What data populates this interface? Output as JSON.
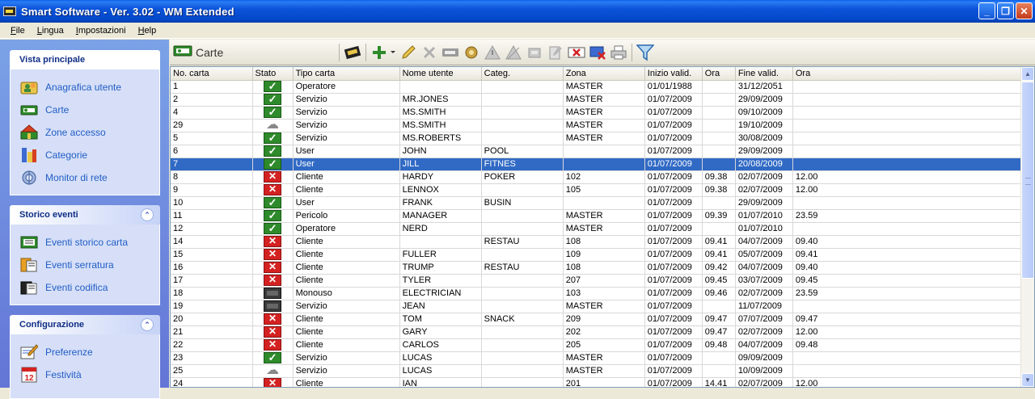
{
  "window": {
    "title": "Smart Software - Ver. 3.02 - WM Extended",
    "minimize": "_",
    "maximize": "❐",
    "close": "✕"
  },
  "menu": [
    {
      "label": "File",
      "accel": "F",
      "rest": "ile"
    },
    {
      "label": "Lingua",
      "accel": "L",
      "rest": "ingua"
    },
    {
      "label": "Impostazioni",
      "accel": "I",
      "rest": "mpostazioni"
    },
    {
      "label": "Help",
      "accel": "H",
      "rest": "elp"
    }
  ],
  "sidebar": {
    "groups": [
      {
        "title": "Vista principale",
        "items": [
          {
            "label": "Anagrafica utente",
            "icon": "users-icon"
          },
          {
            "label": "Carte",
            "icon": "card-icon"
          },
          {
            "label": "Zone accesso",
            "icon": "house-icon"
          },
          {
            "label": "Categorie",
            "icon": "categories-icon"
          },
          {
            "label": "Monitor di rete",
            "icon": "network-monitor-icon"
          }
        ]
      },
      {
        "title": "Storico eventi",
        "items": [
          {
            "label": "Eventi storico carta",
            "icon": "card-history-icon"
          },
          {
            "label": "Eventi serratura",
            "icon": "lock-events-icon"
          },
          {
            "label": "Eventi codifica",
            "icon": "encoding-events-icon"
          }
        ]
      },
      {
        "title": "Configurazione",
        "items": [
          {
            "label": "Preferenze",
            "icon": "preferences-icon"
          },
          {
            "label": "Festività",
            "icon": "calendar-icon"
          }
        ]
      }
    ]
  },
  "toolbar": {
    "title": "Carte"
  },
  "grid": {
    "columns": [
      "No. carta",
      "Stato",
      "Tipo carta",
      "Nome utente",
      "Categ.",
      "Zona",
      "Inizio valid.",
      "Ora",
      "Fine valid.",
      "Ora"
    ],
    "rows": [
      {
        "n": "1",
        "s": "ok",
        "t": "Operatore",
        "u": "",
        "c": "",
        "z": "MASTER",
        "iv": "01/01/1988",
        "io": "",
        "fv": "31/12/2051",
        "fo": ""
      },
      {
        "n": "2",
        "s": "ok",
        "t": "Servizio",
        "u": "MR.JONES",
        "c": "",
        "z": "MASTER",
        "iv": "01/07/2009",
        "io": "",
        "fv": "29/09/2009",
        "fo": ""
      },
      {
        "n": "4",
        "s": "ok",
        "t": "Servizio",
        "u": "MS.SMITH",
        "c": "",
        "z": "MASTER",
        "iv": "01/07/2009",
        "io": "",
        "fv": "09/10/2009",
        "fo": ""
      },
      {
        "n": "29",
        "s": "cloud",
        "t": "Servizio",
        "u": "MS.SMITH",
        "c": "",
        "z": "MASTER",
        "iv": "01/07/2009",
        "io": "",
        "fv": "19/10/2009",
        "fo": ""
      },
      {
        "n": "5",
        "s": "ok",
        "t": "Servizio",
        "u": "MS.ROBERTS",
        "c": "",
        "z": "MASTER",
        "iv": "01/07/2009",
        "io": "",
        "fv": "30/08/2009",
        "fo": ""
      },
      {
        "n": "6",
        "s": "ok",
        "t": "User",
        "u": "JOHN",
        "c": "POOL",
        "z": "",
        "iv": "01/07/2009",
        "io": "",
        "fv": "29/09/2009",
        "fo": ""
      },
      {
        "n": "7",
        "s": "ok",
        "t": "User",
        "u": "JILL",
        "c": "FITNES",
        "z": "",
        "iv": "01/07/2009",
        "io": "",
        "fv": "20/08/2009",
        "fo": "",
        "selected": true
      },
      {
        "n": "8",
        "s": "no",
        "t": "Cliente",
        "u": "HARDY",
        "c": "POKER",
        "z": "102",
        "iv": "01/07/2009",
        "io": "09.38",
        "fv": "02/07/2009",
        "fo": "12.00"
      },
      {
        "n": "9",
        "s": "no",
        "t": "Cliente",
        "u": "LENNOX",
        "c": "",
        "z": "105",
        "iv": "01/07/2009",
        "io": "09.38",
        "fv": "02/07/2009",
        "fo": "12.00"
      },
      {
        "n": "10",
        "s": "ok",
        "t": "User",
        "u": "FRANK",
        "c": "BUSIN",
        "z": "",
        "iv": "01/07/2009",
        "io": "",
        "fv": "29/09/2009",
        "fo": ""
      },
      {
        "n": "11",
        "s": "ok",
        "t": "Pericolo",
        "u": "MANAGER",
        "c": "",
        "z": "MASTER",
        "iv": "01/07/2009",
        "io": "09.39",
        "fv": "01/07/2010",
        "fo": "23.59"
      },
      {
        "n": "12",
        "s": "ok",
        "t": "Operatore",
        "u": "NERD",
        "c": "",
        "z": "MASTER",
        "iv": "01/07/2009",
        "io": "",
        "fv": "01/07/2010",
        "fo": ""
      },
      {
        "n": "14",
        "s": "no",
        "t": "Cliente",
        "u": "",
        "c": "RESTAU",
        "z": "108",
        "iv": "01/07/2009",
        "io": "09.41",
        "fv": "04/07/2009",
        "fo": "09.40"
      },
      {
        "n": "15",
        "s": "no",
        "t": "Cliente",
        "u": "FULLER",
        "c": "",
        "z": "109",
        "iv": "01/07/2009",
        "io": "09.41",
        "fv": "05/07/2009",
        "fo": "09.41"
      },
      {
        "n": "16",
        "s": "no",
        "t": "Cliente",
        "u": "TRUMP",
        "c": "RESTAU",
        "z": "108",
        "iv": "01/07/2009",
        "io": "09.42",
        "fv": "04/07/2009",
        "fo": "09.40"
      },
      {
        "n": "17",
        "s": "no",
        "t": "Cliente",
        "u": "TYLER",
        "c": "",
        "z": "207",
        "iv": "01/07/2009",
        "io": "09.45",
        "fv": "03/07/2009",
        "fo": "09.45"
      },
      {
        "n": "18",
        "s": "off",
        "t": "Monouso",
        "u": "ELECTRICIAN",
        "c": "",
        "z": "103",
        "iv": "01/07/2009",
        "io": "09.46",
        "fv": "02/07/2009",
        "fo": "23.59"
      },
      {
        "n": "19",
        "s": "off",
        "t": "Servizio",
        "u": "JEAN",
        "c": "",
        "z": "MASTER",
        "iv": "01/07/2009",
        "io": "",
        "fv": "11/07/2009",
        "fo": ""
      },
      {
        "n": "20",
        "s": "no",
        "t": "Cliente",
        "u": "TOM",
        "c": "SNACK",
        "z": "209",
        "iv": "01/07/2009",
        "io": "09.47",
        "fv": "07/07/2009",
        "fo": "09.47"
      },
      {
        "n": "21",
        "s": "no",
        "t": "Cliente",
        "u": "GARY",
        "c": "",
        "z": "202",
        "iv": "01/07/2009",
        "io": "09.47",
        "fv": "02/07/2009",
        "fo": "12.00"
      },
      {
        "n": "22",
        "s": "no",
        "t": "Cliente",
        "u": "CARLOS",
        "c": "",
        "z": "205",
        "iv": "01/07/2009",
        "io": "09.48",
        "fv": "04/07/2009",
        "fo": "09.48"
      },
      {
        "n": "23",
        "s": "ok",
        "t": "Servizio",
        "u": "LUCAS",
        "c": "",
        "z": "MASTER",
        "iv": "01/07/2009",
        "io": "",
        "fv": "09/09/2009",
        "fo": ""
      },
      {
        "n": "25",
        "s": "cloud",
        "t": "Servizio",
        "u": "LUCAS",
        "c": "",
        "z": "MASTER",
        "iv": "01/07/2009",
        "io": "",
        "fv": "10/09/2009",
        "fo": ""
      },
      {
        "n": "24",
        "s": "no",
        "t": "Cliente",
        "u": "IAN",
        "c": "",
        "z": "201",
        "iv": "01/07/2009",
        "io": "14.41",
        "fv": "02/07/2009",
        "fo": "12.00"
      }
    ]
  }
}
